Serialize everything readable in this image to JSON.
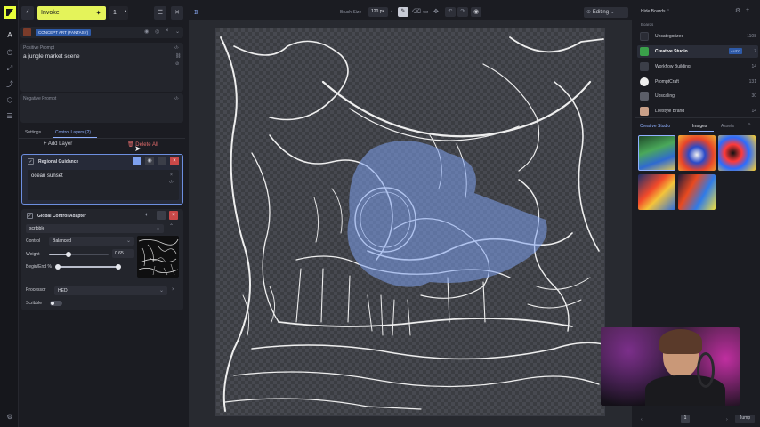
{
  "toolbar": {
    "invoke_label": "Invoke",
    "iterations": "1",
    "brush_size_label": "Brush Size",
    "brush_size_value": "120 px",
    "mode_label": "Editing"
  },
  "prompt": {
    "style_badge": "CONCEPT ART (FANTASY)",
    "positive_label": "Positive Prompt",
    "positive_value": "a jungle market scene",
    "negative_label": "Negative Prompt"
  },
  "tabs": {
    "settings": "Settings",
    "control_layers": "Control Layers (2)"
  },
  "layers": {
    "add_label": "Add Layer",
    "delete_all_label": "Delete All",
    "regional": {
      "title": "Regional Guidance",
      "prompt": "ocean sunset"
    },
    "global": {
      "title": "Global Control Adapter",
      "model": "scribble",
      "control_label": "Control",
      "control_value": "Balanced",
      "weight_label": "Weight",
      "weight_value": "0.65",
      "weight_fraction": 0.33,
      "begin_end_label": "Begin/End %",
      "begin_fraction": 0.0,
      "end_fraction": 1.0,
      "processor_label": "Processor",
      "processor_value": "HED",
      "scribble_label": "Scribble"
    }
  },
  "boards_panel": {
    "hide_label": "Hide Boards",
    "boards_label": "Boards",
    "boards": [
      {
        "name": "Uncategorized",
        "count": "1108",
        "color": "#2a2c35"
      },
      {
        "name": "Creative Studio",
        "count": "7",
        "badge": "AUTO",
        "color": "#3aa04a"
      },
      {
        "name": "Workflow Building",
        "count": "14",
        "color": "#3b3e48"
      },
      {
        "name": "PromptCraft",
        "count": "131",
        "color": "#151515"
      },
      {
        "name": "Upscaling",
        "count": "30",
        "color": "#5b5e68"
      },
      {
        "name": "Lifestyle Brand",
        "count": "14",
        "color": "#c9a089"
      }
    ],
    "gallery_title": "Creative Studio",
    "tab_images": "Images",
    "tab_assets": "Assets",
    "page_number": "1",
    "jump_label": "Jump"
  },
  "colors": {
    "accent": "#e4f35a",
    "selection": "#6d8fe0",
    "danger": "#d04040"
  }
}
